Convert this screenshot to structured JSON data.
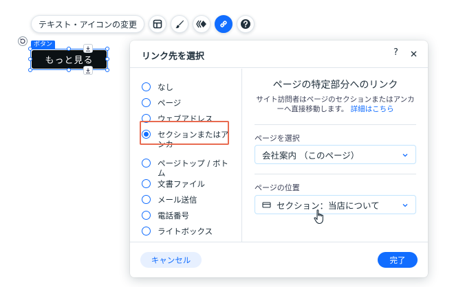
{
  "toolbar": {
    "text_icon_button": "テキスト・アイコンの変更",
    "icons": [
      "layout-icon",
      "brush-icon",
      "animation-icon",
      "link-icon",
      "help-icon"
    ]
  },
  "canvas": {
    "selection_label": "ボタン",
    "button_text": "もっと見る"
  },
  "dialog": {
    "title": "リンク先を選択",
    "help": "?",
    "options": [
      {
        "label": "なし",
        "checked": false
      },
      {
        "label": "ページ",
        "checked": false
      },
      {
        "label": "ウェブアドレス",
        "checked": false
      },
      {
        "label": "セクションまたはアンカー",
        "checked": true
      },
      {
        "label": "ページトップ / ボトム",
        "checked": false
      },
      {
        "label": "文書ファイル",
        "checked": false
      },
      {
        "label": "メール送信",
        "checked": false
      },
      {
        "label": "電話番号",
        "checked": false
      },
      {
        "label": "ライトボックス",
        "checked": false
      }
    ],
    "right": {
      "title": "ページの特定部分へのリンク",
      "description": "サイト訪問者はページのセクションまたはアンカーへ直接移動します。",
      "learn_more": "詳細はこちら",
      "page_label": "ページを選択",
      "page_value": "会社案内 （このページ）",
      "position_label": "ページの位置",
      "position_value": "セクション：当店について"
    },
    "cancel": "キャンセル",
    "done": "完了"
  },
  "colors": {
    "accent": "#116dff",
    "highlight": "#e86a4f",
    "button_bg": "#0b1114"
  }
}
